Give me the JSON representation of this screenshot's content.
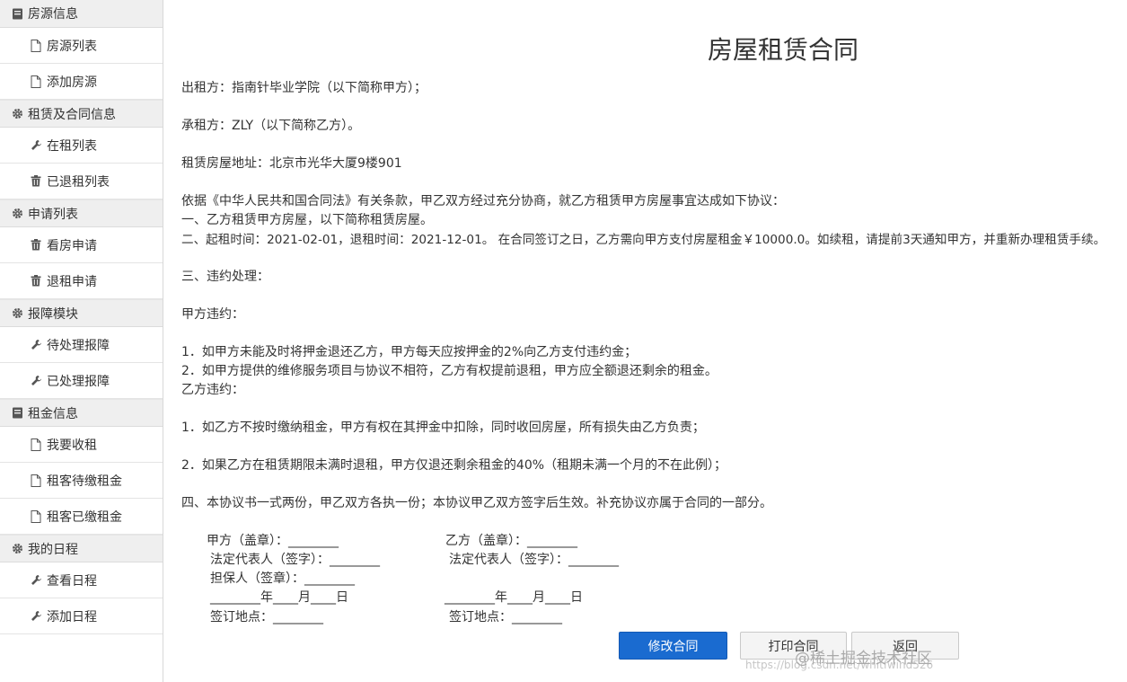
{
  "sidebar": {
    "groups": [
      {
        "title": "房源信息",
        "items": [
          "房源列表",
          "添加房源"
        ]
      },
      {
        "title": "租赁及合同信息",
        "items": [
          "在租列表",
          "已退租列表"
        ]
      },
      {
        "title": "申请列表",
        "items": [
          "看房申请",
          "退租申请"
        ]
      },
      {
        "title": "报障模块",
        "items": [
          "待处理报障",
          "已处理报障"
        ]
      },
      {
        "title": "租金信息",
        "items": [
          "我要收租",
          "租客待缴租金",
          "租客已缴租金"
        ]
      },
      {
        "title": "我的日程",
        "items": [
          "查看日程",
          "添加日程"
        ]
      }
    ]
  },
  "contract": {
    "title": "房屋租赁合同",
    "lessor": "出租方：指南针毕业学院（以下简称甲方）；",
    "lessee": "承租方：ZLY（以下简称乙方）。",
    "address": "租赁房屋地址：北京市光华大厦9楼901",
    "intro": "依据《中华人民共和国合同法》有关条款，甲乙双方经过充分协商，就乙方租赁甲方房屋事宜达成如下协议：",
    "clause1": "一、乙方租赁甲方房屋，以下简称租赁房屋。",
    "clause2": "二、起租时间：2021-02-01，退租时间：2021-12-01。 在合同签订之日，乙方需向甲方支付房屋租金￥10000.0。如续租，请提前3天通知甲方，并重新办理租赁手续。",
    "clause3": "三、违约处理：",
    "party_a_breach": "甲方违约：",
    "a1": "1．如甲方未能及时将押金退还乙方，甲方每天应按押金的2%向乙方支付违约金；",
    "a2": "2．如甲方提供的维修服务项目与协议不相符，乙方有权提前退租，甲方应全额退还剩余的租金。",
    "party_b_breach": "乙方违约：",
    "b1": "1．如乙方不按时缴纳租金，甲方有权在其押金中扣除，同时收回房屋，所有损失由乙方负责；",
    "b2": "2．如果乙方在租赁期限未满时退租，甲方仅退还剩余租金的40%（租期未满一个月的不在此例）；",
    "clause4": "四、本协议书一式两份，甲乙双方各执一份；本协议甲乙双方签字后生效。补充协议亦属于合同的一部分。",
    "sign": {
      "a_seal": "甲方（盖章）：________",
      "a_rep": "法定代表人（签字）：________",
      "guarantor": "担保人（签章）：________",
      "a_date": "________年____月____日",
      "a_place": "签订地点：________",
      "b_seal": "乙方（盖章）：________",
      "b_rep": "法定代表人（签字）：________",
      "b_date": "________年____月____日",
      "b_place": "签订地点：________"
    }
  },
  "buttons": {
    "edit": "修改合同",
    "print": "打印合同",
    "back": "返回"
  },
  "watermark": {
    "main": "@稀土掘金技术社区",
    "url": "https://blog.csdn.net/whitfwind526"
  }
}
